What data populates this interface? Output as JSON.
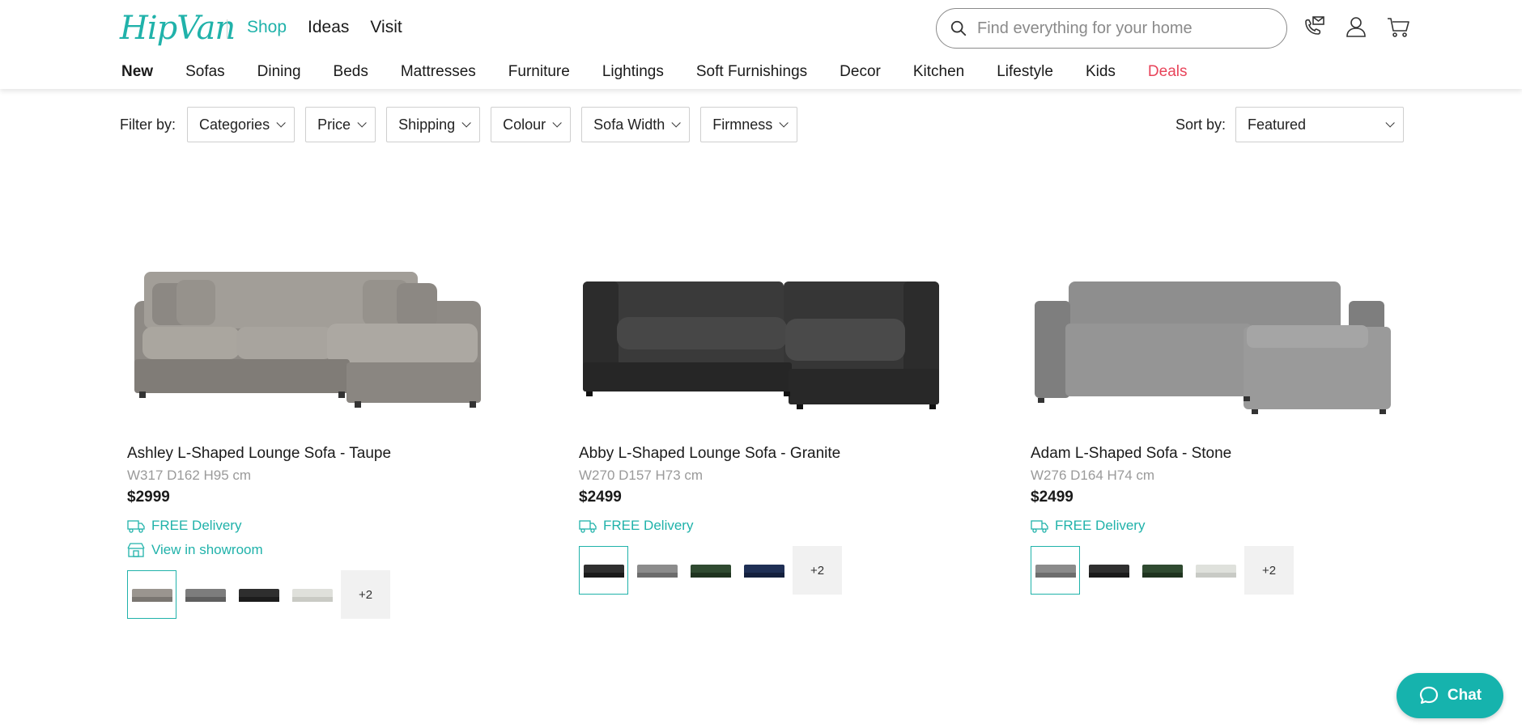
{
  "header": {
    "logo": "HipVan",
    "top_nav": [
      {
        "label": "Shop",
        "active": true
      },
      {
        "label": "Ideas",
        "active": false
      },
      {
        "label": "Visit",
        "active": false
      }
    ],
    "search": {
      "placeholder": "Find everything for your home",
      "value": "",
      "icon": "search-icon"
    },
    "icons": [
      "contact-icon",
      "account-icon",
      "cart-icon"
    ],
    "categories": [
      "New",
      "Sofas",
      "Dining",
      "Beds",
      "Mattresses",
      "Furniture",
      "Lightings",
      "Soft Furnishings",
      "Decor",
      "Kitchen",
      "Lifestyle",
      "Kids",
      "Deals"
    ]
  },
  "filters": {
    "label": "Filter by:",
    "items": [
      "Categories",
      "Price",
      "Shipping",
      "Colour",
      "Sofa Width",
      "Firmness"
    ]
  },
  "sort": {
    "label": "Sort by:",
    "value": "Featured"
  },
  "products": [
    {
      "name": "Ashley L-Shaped Lounge Sofa - Taupe",
      "dims": "W317 D162 H95 cm",
      "price": "$2999",
      "delivery": "FREE Delivery",
      "showroom": "View in showroom",
      "colors": [
        "#9a958f",
        "#7d7d7d",
        "#2e2e2e",
        "#dfe0db"
      ],
      "more": "+2"
    },
    {
      "name": "Abby L-Shaped Lounge Sofa - Granite",
      "dims": "W270 D157 H73 cm",
      "price": "$2499",
      "delivery": "FREE Delivery",
      "colors": [
        "#2f2f2f",
        "#8c8c8c",
        "#2f4a30",
        "#1f2f55"
      ],
      "more": "+2"
    },
    {
      "name": "Adam L-Shaped Sofa - Stone",
      "dims": "W276 D164 H74 cm",
      "price": "$2499",
      "delivery": "FREE Delivery",
      "colors": [
        "#8b8b8b",
        "#2f2f2f",
        "#2f4a30",
        "#dfe1dc"
      ],
      "more": "+2"
    }
  ],
  "chat": {
    "label": "Chat"
  },
  "colors": {
    "accent": "#20b2aa",
    "deals": "#e8445a",
    "chat": "#16b3ad"
  }
}
